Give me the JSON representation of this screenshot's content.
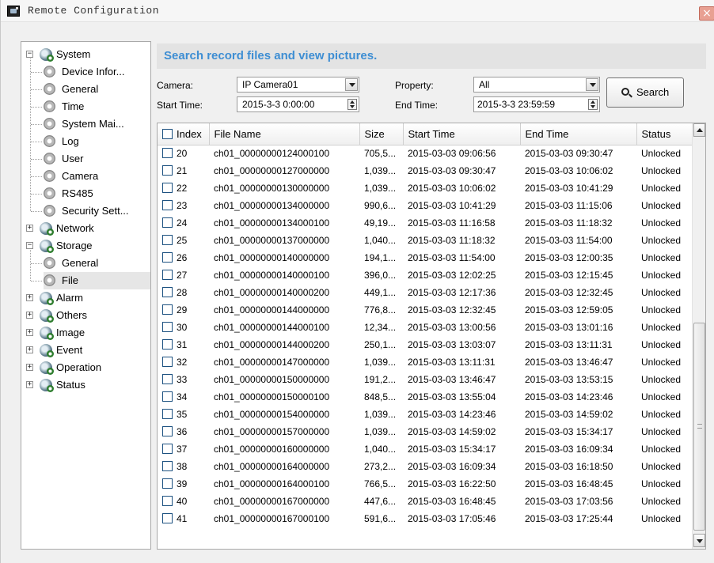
{
  "window": {
    "title": "Remote Configuration",
    "close_label": "×"
  },
  "tree": {
    "system": "System",
    "system_children": [
      "Device Infor...",
      "General",
      "Time",
      "System Mai...",
      "Log",
      "User",
      "Camera",
      "RS485",
      "Security Sett..."
    ],
    "network": "Network",
    "storage": "Storage",
    "storage_children": [
      "General",
      "File"
    ],
    "others_nodes": [
      "Alarm",
      "Others",
      "Image",
      "Event",
      "Operation",
      "Status"
    ],
    "selected": "File"
  },
  "panel": {
    "title": "Search record files and view pictures."
  },
  "search": {
    "camera_label": "Camera:",
    "camera_value": "IP Camera01",
    "property_label": "Property:",
    "property_value": "All",
    "start_label": "Start Time:",
    "start_value": "2015-3-3 0:00:00",
    "end_label": "End Time:",
    "end_value": "2015-3-3 23:59:59",
    "button_label": "Search"
  },
  "table": {
    "columns": [
      "Index",
      "File Name",
      "Size",
      "Start Time",
      "End Time",
      "Status"
    ],
    "rows": [
      [
        "20",
        "ch01_00000000124000100",
        "705,5...",
        "2015-03-03 09:06:56",
        "2015-03-03 09:30:47",
        "Unlocked"
      ],
      [
        "21",
        "ch01_00000000127000000",
        "1,039...",
        "2015-03-03 09:30:47",
        "2015-03-03 10:06:02",
        "Unlocked"
      ],
      [
        "22",
        "ch01_00000000130000000",
        "1,039...",
        "2015-03-03 10:06:02",
        "2015-03-03 10:41:29",
        "Unlocked"
      ],
      [
        "23",
        "ch01_00000000134000000",
        "990,6...",
        "2015-03-03 10:41:29",
        "2015-03-03 11:15:06",
        "Unlocked"
      ],
      [
        "24",
        "ch01_00000000134000100",
        "49,19...",
        "2015-03-03 11:16:58",
        "2015-03-03 11:18:32",
        "Unlocked"
      ],
      [
        "25",
        "ch01_00000000137000000",
        "1,040...",
        "2015-03-03 11:18:32",
        "2015-03-03 11:54:00",
        "Unlocked"
      ],
      [
        "26",
        "ch01_00000000140000000",
        "194,1...",
        "2015-03-03 11:54:00",
        "2015-03-03 12:00:35",
        "Unlocked"
      ],
      [
        "27",
        "ch01_00000000140000100",
        "396,0...",
        "2015-03-03 12:02:25",
        "2015-03-03 12:15:45",
        "Unlocked"
      ],
      [
        "28",
        "ch01_00000000140000200",
        "449,1...",
        "2015-03-03 12:17:36",
        "2015-03-03 12:32:45",
        "Unlocked"
      ],
      [
        "29",
        "ch01_00000000144000000",
        "776,8...",
        "2015-03-03 12:32:45",
        "2015-03-03 12:59:05",
        "Unlocked"
      ],
      [
        "30",
        "ch01_00000000144000100",
        "12,34...",
        "2015-03-03 13:00:56",
        "2015-03-03 13:01:16",
        "Unlocked"
      ],
      [
        "31",
        "ch01_00000000144000200",
        "250,1...",
        "2015-03-03 13:03:07",
        "2015-03-03 13:11:31",
        "Unlocked"
      ],
      [
        "32",
        "ch01_00000000147000000",
        "1,039...",
        "2015-03-03 13:11:31",
        "2015-03-03 13:46:47",
        "Unlocked"
      ],
      [
        "33",
        "ch01_00000000150000000",
        "191,2...",
        "2015-03-03 13:46:47",
        "2015-03-03 13:53:15",
        "Unlocked"
      ],
      [
        "34",
        "ch01_00000000150000100",
        "848,5...",
        "2015-03-03 13:55:04",
        "2015-03-03 14:23:46",
        "Unlocked"
      ],
      [
        "35",
        "ch01_00000000154000000",
        "1,039...",
        "2015-03-03 14:23:46",
        "2015-03-03 14:59:02",
        "Unlocked"
      ],
      [
        "36",
        "ch01_00000000157000000",
        "1,039...",
        "2015-03-03 14:59:02",
        "2015-03-03 15:34:17",
        "Unlocked"
      ],
      [
        "37",
        "ch01_00000000160000000",
        "1,040...",
        "2015-03-03 15:34:17",
        "2015-03-03 16:09:34",
        "Unlocked"
      ],
      [
        "38",
        "ch01_00000000164000000",
        "273,2...",
        "2015-03-03 16:09:34",
        "2015-03-03 16:18:50",
        "Unlocked"
      ],
      [
        "39",
        "ch01_00000000164000100",
        "766,5...",
        "2015-03-03 16:22:50",
        "2015-03-03 16:48:45",
        "Unlocked"
      ],
      [
        "40",
        "ch01_00000000167000000",
        "447,6...",
        "2015-03-03 16:48:45",
        "2015-03-03 17:03:56",
        "Unlocked"
      ],
      [
        "41",
        "ch01_00000000167000100",
        "591,6...",
        "2015-03-03 17:05:46",
        "2015-03-03 17:25:44",
        "Unlocked"
      ]
    ]
  },
  "colors": {
    "accent": "#3e8ed3",
    "panel_bg": "#f0f0f0",
    "selection": "#e6e6e6"
  }
}
